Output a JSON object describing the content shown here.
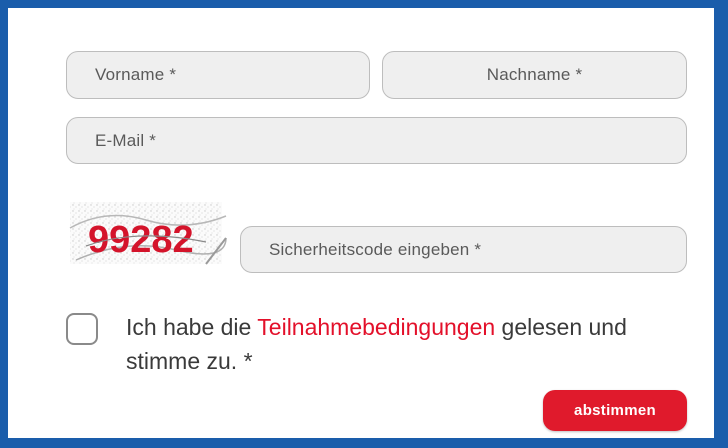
{
  "form": {
    "first_name_placeholder": "Vorname *",
    "last_name_placeholder": "Nachname *",
    "email_placeholder": "E-Mail *",
    "captcha_text": "99282",
    "captcha_code_placeholder": "Sicherheitscode eingeben *",
    "consent_prefix": "Ich habe die ",
    "consent_link": "Teilnahmebedingungen",
    "consent_suffix": " gelesen und stimme zu. *",
    "submit_label": "abstimmen"
  },
  "colors": {
    "frame_border": "#1a5dab",
    "accent_red": "#e01a2c",
    "field_bg": "#efefef"
  }
}
